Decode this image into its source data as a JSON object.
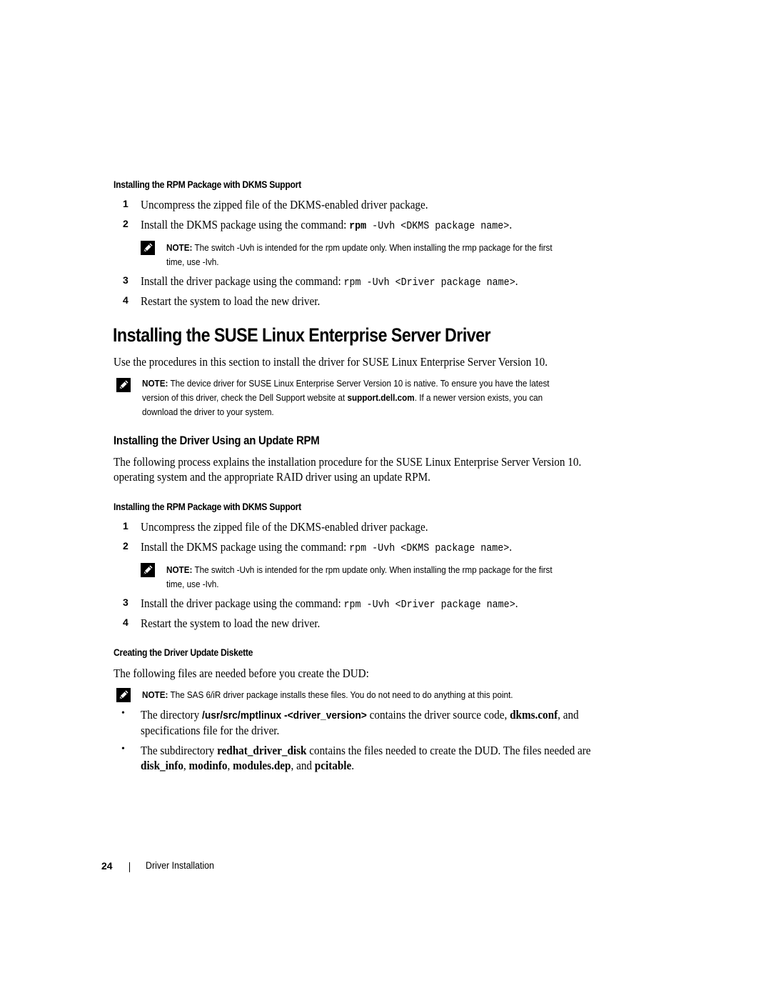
{
  "section1": {
    "subheading": "Installing the RPM Package with DKMS Support",
    "steps": [
      {
        "num": "1",
        "text": "Uncompress the zipped file of the DKMS-enabled driver package."
      },
      {
        "num": "2",
        "text": "Install the DKMS package using the command: ",
        "code_cmd": "rpm",
        "code_rest": " -Uvh <DKMS package name>",
        "tail": "."
      },
      {
        "num": "3",
        "text": "Install the driver package using the command: ",
        "code": "rpm -Uvh <Driver package name>",
        "tail": "."
      },
      {
        "num": "4",
        "text": "Restart the system to load the new driver."
      }
    ],
    "note": {
      "label": "NOTE:",
      "line1": " The switch -Uvh is intended for the rpm update only. When installing the rmp package for the first",
      "line2": "time, use -Ivh."
    }
  },
  "main_heading": "Installing the SUSE Linux Enterprise Server Driver",
  "intro": "Use the procedures in this section to install the driver for SUSE Linux Enterprise Server Version 10.",
  "intro_note": {
    "label": "NOTE:",
    "line1": " The device driver for SUSE Linux Enterprise Server Version 10 is native. To ensure you have the latest",
    "line2_pre": "version of this driver, check the Dell Support website at ",
    "line2_link": "support.dell.com",
    "line2_post": ". If a newer version exists, you can",
    "line3": "download the driver to your system."
  },
  "section2": {
    "heading": "Installing the Driver Using an Update RPM",
    "para_line1": "The following process explains the installation procedure for the SUSE Linux Enterprise Server Version 10.",
    "para_line2": "operating system and the appropriate RAID driver using an update RPM.",
    "subheading": "Installing the RPM Package with DKMS Support",
    "steps": [
      {
        "num": "1",
        "text": "Uncompress the zipped file of the DKMS-enabled driver package."
      },
      {
        "num": "2",
        "text": "Install the DKMS package using the command: ",
        "code": "rpm -Uvh <DKMS package name>",
        "tail": "."
      },
      {
        "num": "3",
        "text": "Install the driver package using the command: ",
        "code": "rpm -Uvh <Driver package name>",
        "tail": "."
      },
      {
        "num": "4",
        "text": "Restart the system to load the new driver."
      }
    ],
    "note": {
      "label": "NOTE:",
      "line1": " The switch -Uvh is intended for the rpm update only. When installing the rmp package for the first",
      "line2": "time, use -Ivh."
    }
  },
  "section3": {
    "subheading": "Creating the Driver Update Diskette",
    "para": "The following files are needed before you create the DUD:",
    "note": {
      "label": "NOTE:",
      "text": " The SAS 6/iR driver package installs these files. You do not need to do anything at this point."
    },
    "bullets": [
      {
        "pre": "The directory ",
        "bold": "/usr/src/mptlinux -<driver_version>",
        "mid": " contains the driver source code, ",
        "bold2": "dkms.conf",
        "post": ", and",
        "line2": "specifications file for the driver."
      },
      {
        "pre": "The subdirectory ",
        "bold": "redhat_driver_disk",
        "post": " contains the files needed to create the DUD. The files needed are",
        "l2_b1": "disk_info",
        "l2_s1": ", ",
        "l2_b2": "modinfo",
        "l2_s2": ", ",
        "l2_b3": "modules.dep",
        "l2_s3": ", and ",
        "l2_b4": "pcitable",
        "l2_s4": "."
      }
    ],
    "bullet_char": "•"
  },
  "footer": {
    "page_number": "24",
    "section_title": "Driver Installation"
  }
}
